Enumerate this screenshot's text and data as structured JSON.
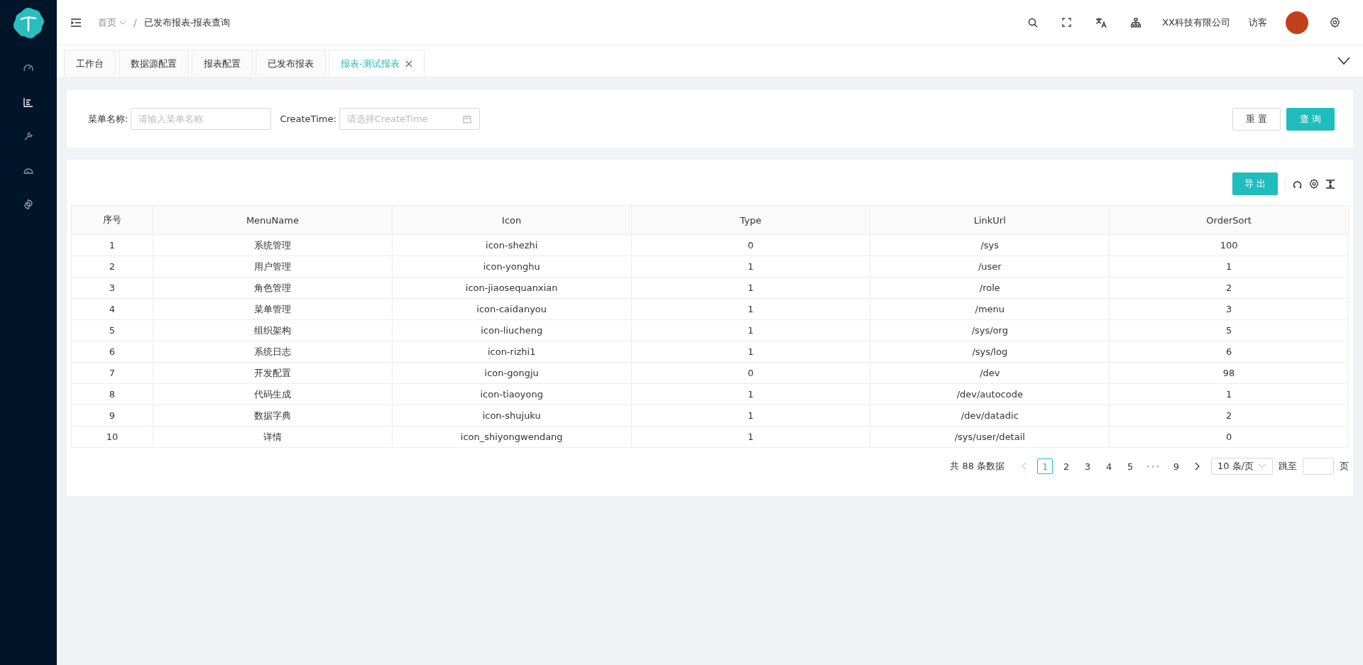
{
  "sidebar": {
    "items": [
      {
        "selected": false
      },
      {
        "selected": true
      },
      {
        "selected": false
      },
      {
        "selected": false
      },
      {
        "selected": false
      }
    ]
  },
  "header": {
    "breadcrumb": [
      {
        "label": "首页",
        "dropdown": true
      },
      {
        "label": "已发布报表-报表查询",
        "dropdown": false
      }
    ],
    "separator": "/",
    "company": "XX科技有限公司",
    "user": "访客"
  },
  "tabs": [
    {
      "label": "工作台",
      "selected": false,
      "closable": false
    },
    {
      "label": "数据源配置",
      "selected": false,
      "closable": false
    },
    {
      "label": "报表配置",
      "selected": false,
      "closable": false
    },
    {
      "label": "已发布报表",
      "selected": false,
      "closable": false
    },
    {
      "label": "报表-测试报表",
      "selected": true,
      "closable": true
    }
  ],
  "filters": [
    {
      "label": "菜单名称:",
      "placeholder": "请输入菜单名称",
      "kind": "text"
    },
    {
      "label": "CreateTime:",
      "placeholder": "请选择CreateTime",
      "kind": "date"
    }
  ],
  "filter_buttons": [
    {
      "label": "重 置",
      "kind": "default"
    },
    {
      "label": "查 询",
      "kind": "primary"
    }
  ],
  "export_button": "导 出",
  "table": {
    "columns": [
      "序号",
      "MenuName",
      "Icon",
      "Type",
      "LinkUrl",
      "OrderSort"
    ],
    "rows": [
      [
        "1",
        "系统管理",
        "icon-shezhi",
        "0",
        "/sys",
        "100"
      ],
      [
        "2",
        "用户管理",
        "icon-yonghu",
        "1",
        "/user",
        "1"
      ],
      [
        "3",
        "角色管理",
        "icon-jiaosequanxian",
        "1",
        "/role",
        "2"
      ],
      [
        "4",
        "菜单管理",
        "icon-caidanyou",
        "1",
        "/menu",
        "3"
      ],
      [
        "5",
        "组织架构",
        "icon-liucheng",
        "1",
        "/sys/org",
        "5"
      ],
      [
        "6",
        "系统日志",
        "icon-rizhi1",
        "1",
        "/sys/log",
        "6"
      ],
      [
        "7",
        "开发配置",
        "icon-gongju",
        "0",
        "/dev",
        "98"
      ],
      [
        "8",
        "代码生成",
        "icon-tiaoyong",
        "1",
        "/dev/autocode",
        "1"
      ],
      [
        "9",
        "数据字典",
        "icon-shujuku",
        "1",
        "/dev/datadic",
        "2"
      ],
      [
        "10",
        "详情",
        "icon_shiyongwendang",
        "1",
        "/sys/user/detail",
        "0"
      ]
    ]
  },
  "pagination": {
    "total": "共 88 条数据",
    "prev_disabled": true,
    "next_disabled": false,
    "items": [
      {
        "kind": "page",
        "label": "1",
        "selected": true
      },
      {
        "kind": "page",
        "label": "2",
        "selected": false
      },
      {
        "kind": "page",
        "label": "3",
        "selected": false
      },
      {
        "kind": "page",
        "label": "4",
        "selected": false
      },
      {
        "kind": "page",
        "label": "5",
        "selected": false
      },
      {
        "kind": "ellipsis",
        "label": "•••"
      },
      {
        "kind": "page",
        "label": "9",
        "selected": false
      }
    ],
    "page_size": "10 条/页",
    "jump_label": "跳至",
    "page_unit": "页"
  }
}
